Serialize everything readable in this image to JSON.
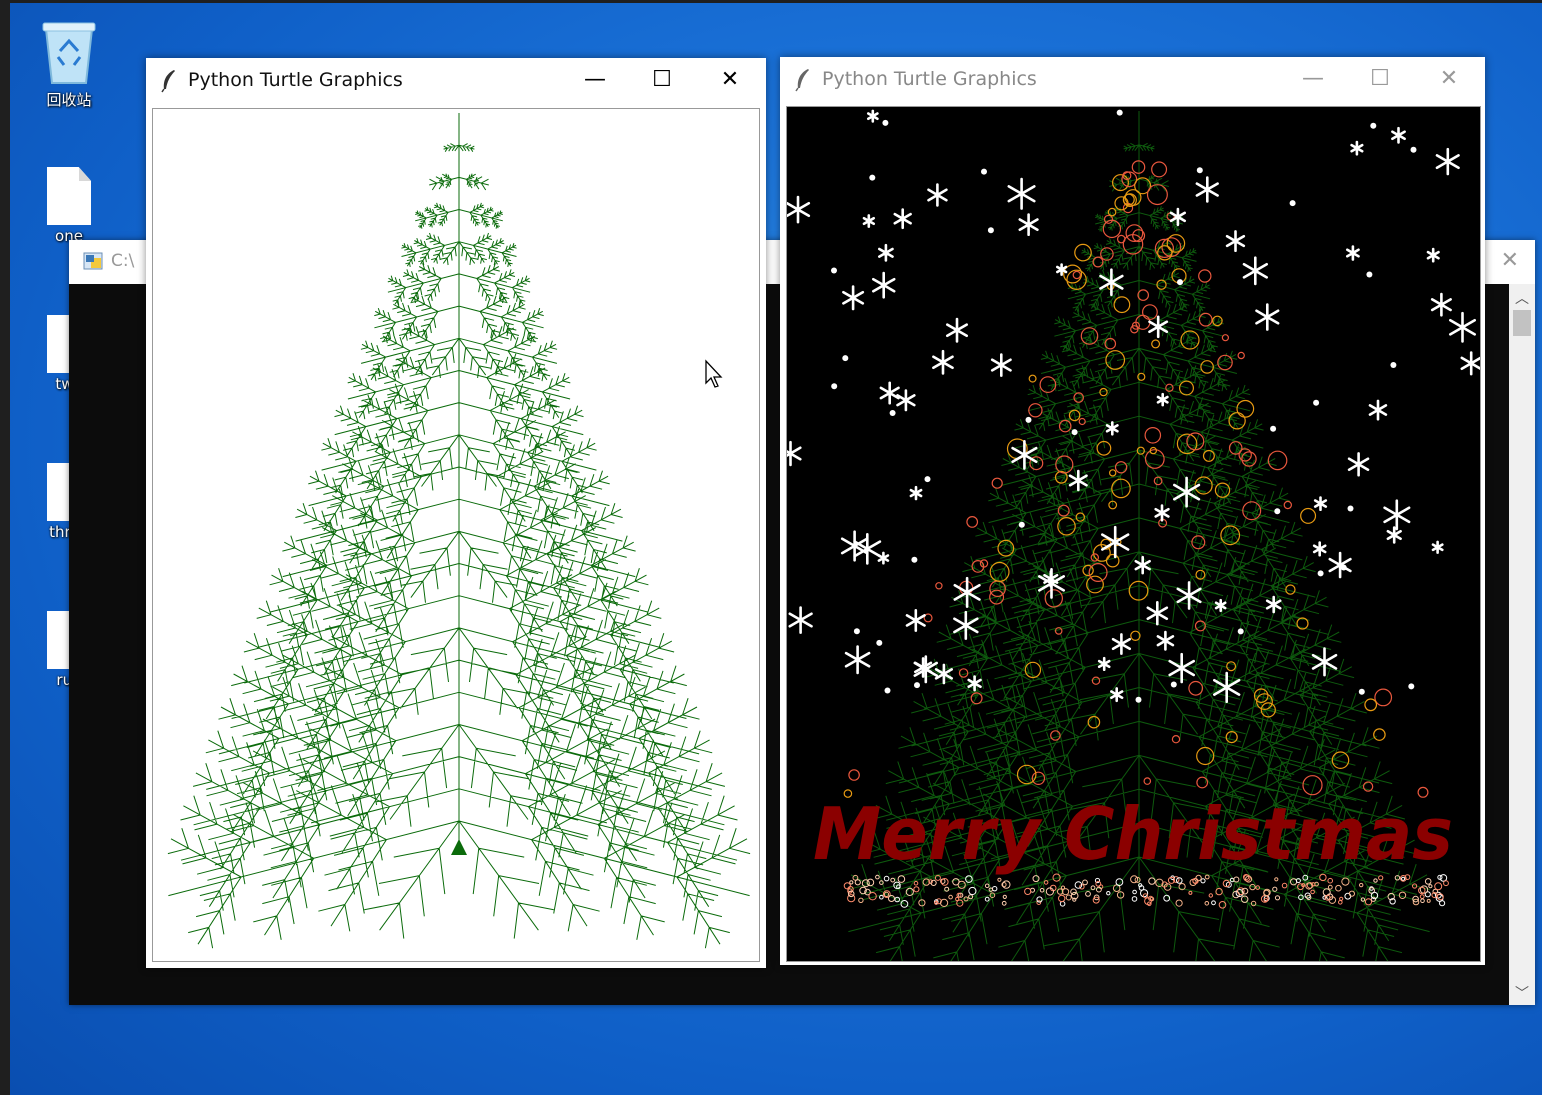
{
  "desktop": {
    "icons": [
      {
        "label": "回收站",
        "kind": "recycle-bin"
      },
      {
        "label": "one",
        "kind": "file"
      },
      {
        "label": "two",
        "kind": "file"
      },
      {
        "label": "three",
        "kind": "file"
      },
      {
        "label": "run",
        "kind": "file"
      }
    ]
  },
  "console": {
    "title": "C:\\",
    "close_symbol": "✕"
  },
  "windows": {
    "left": {
      "title": "Python Turtle Graphics",
      "tree_color": "#0b6b0b",
      "background": "#ffffff"
    },
    "right": {
      "title": "Python Turtle Graphics",
      "greeting": "Merry Christmas",
      "greeting_color": "#8b0000",
      "tree_color": "#0e5a0e",
      "background": "#000000"
    }
  },
  "controls": {
    "minimize": "—",
    "maximize": "☐",
    "close": "✕"
  }
}
